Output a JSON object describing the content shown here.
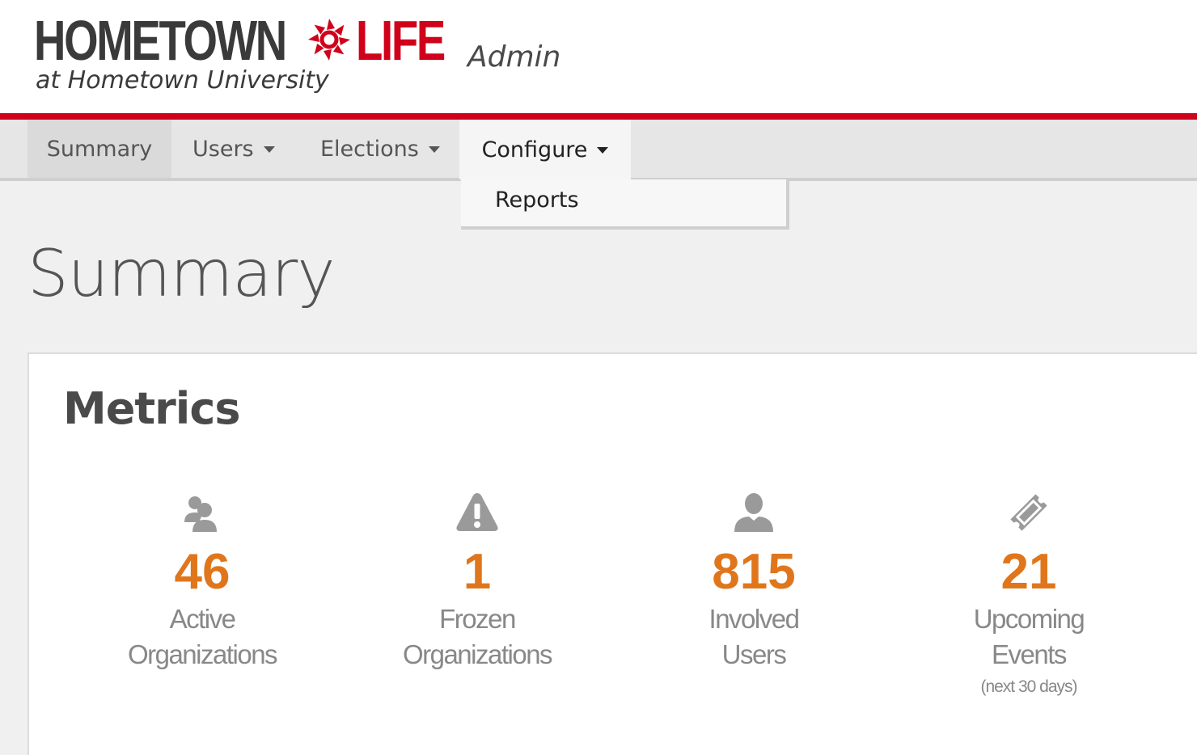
{
  "header": {
    "logo_part1": "HOMETOWN",
    "logo_part2": "LIFE",
    "logo_subtitle": "at Hometown University",
    "section_label": "Admin",
    "brand_color": "#d0021b"
  },
  "nav": {
    "items": [
      {
        "label": "Summary",
        "active": true,
        "has_caret": false
      },
      {
        "label": "Users",
        "has_caret": true
      },
      {
        "label": "Elections",
        "has_caret": true
      },
      {
        "label": "Configure",
        "open": true,
        "has_caret": true
      }
    ],
    "dropdown": {
      "items": [
        {
          "label": "Reports"
        }
      ]
    }
  },
  "page": {
    "title": "Summary"
  },
  "metrics": {
    "title": "Metrics",
    "accent_color": "#e0761b",
    "items": [
      {
        "icon": "users-icon",
        "value": "46",
        "label_line1": "Active",
        "label_line2": "Organizations",
        "sub": ""
      },
      {
        "icon": "warning-icon",
        "value": "1",
        "label_line1": "Frozen",
        "label_line2": "Organizations",
        "sub": ""
      },
      {
        "icon": "user-icon",
        "value": "815",
        "label_line1": "Involved",
        "label_line2": "Users",
        "sub": ""
      },
      {
        "icon": "ticket-icon",
        "value": "21",
        "label_line1": "Upcoming",
        "label_line2": "Events",
        "sub": "(next 30 days)"
      }
    ]
  }
}
